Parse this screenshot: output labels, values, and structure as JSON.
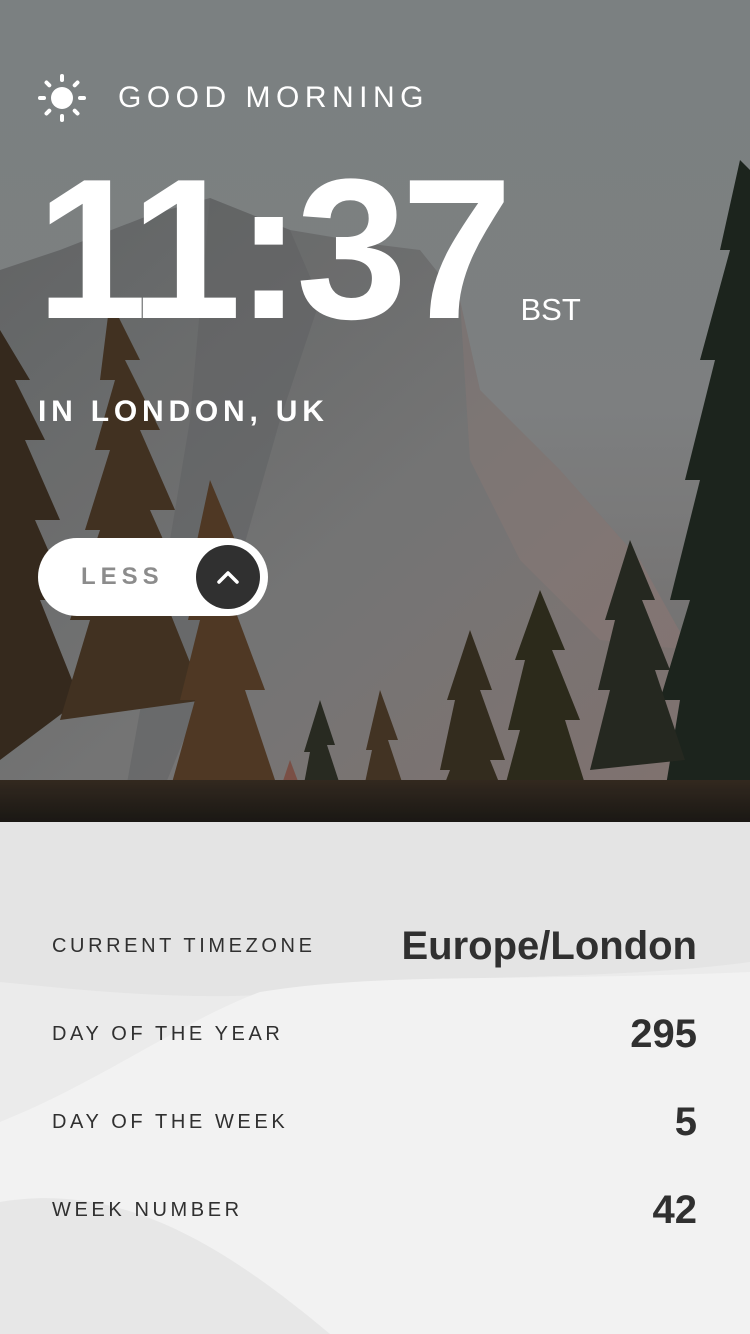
{
  "greeting": {
    "text": "GOOD MORNING",
    "icon": "sun-icon"
  },
  "clock": {
    "time": "11:37",
    "abbreviation": "BST",
    "location": "IN LONDON, UK"
  },
  "toggle": {
    "label": "LESS",
    "icon": "chevron-up-icon"
  },
  "details": [
    {
      "label": "CURRENT TIMEZONE",
      "value": "Europe/London"
    },
    {
      "label": "DAY OF THE YEAR",
      "value": "295"
    },
    {
      "label": "DAY OF THE WEEK",
      "value": "5"
    },
    {
      "label": "WEEK NUMBER",
      "value": "42"
    }
  ],
  "colors": {
    "text_light": "#ffffff",
    "text_dark": "#303030",
    "button_bg": "#ffffff",
    "chevron_bg": "#303030",
    "panel_bg": "#ececec"
  }
}
